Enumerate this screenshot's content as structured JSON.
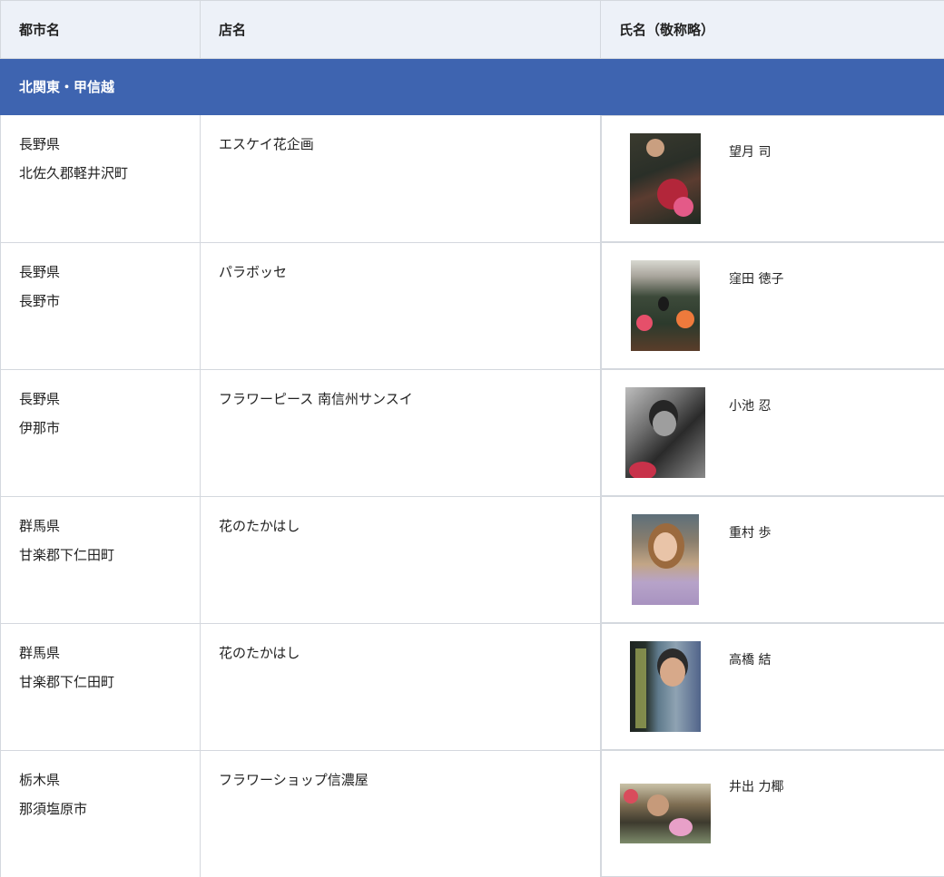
{
  "header": {
    "col_city": "都市名",
    "col_shop": "店名",
    "col_person": "氏名（敬称略）"
  },
  "region": {
    "name": "北関東・甲信越"
  },
  "rows": [
    {
      "pref": "長野県",
      "city": "北佐久郡軽井沢町",
      "shop": "エスケイ花企画",
      "person": "望月 司"
    },
    {
      "pref": "長野県",
      "city": "長野市",
      "shop": "パラボッセ",
      "person": "窪田 徳子"
    },
    {
      "pref": "長野県",
      "city": "伊那市",
      "shop": "フラワーピース 南信州サンスイ",
      "person": "小池 忍"
    },
    {
      "pref": "群馬県",
      "city": "甘楽郡下仁田町",
      "shop": "花のたかはし",
      "person": "重村 歩"
    },
    {
      "pref": "群馬県",
      "city": "甘楽郡下仁田町",
      "shop": "花のたかはし",
      "person": "高橋 結"
    },
    {
      "pref": "栃木県",
      "city": "那須塩原市",
      "shop": "フラワーショップ信濃屋",
      "person": "井出 力椰"
    }
  ],
  "colors": {
    "header_bg": "#edf1f8",
    "region_bg": "#3e64b0",
    "border": "#d4d8de"
  },
  "icons": {
    "photo": "portrait-photo"
  }
}
